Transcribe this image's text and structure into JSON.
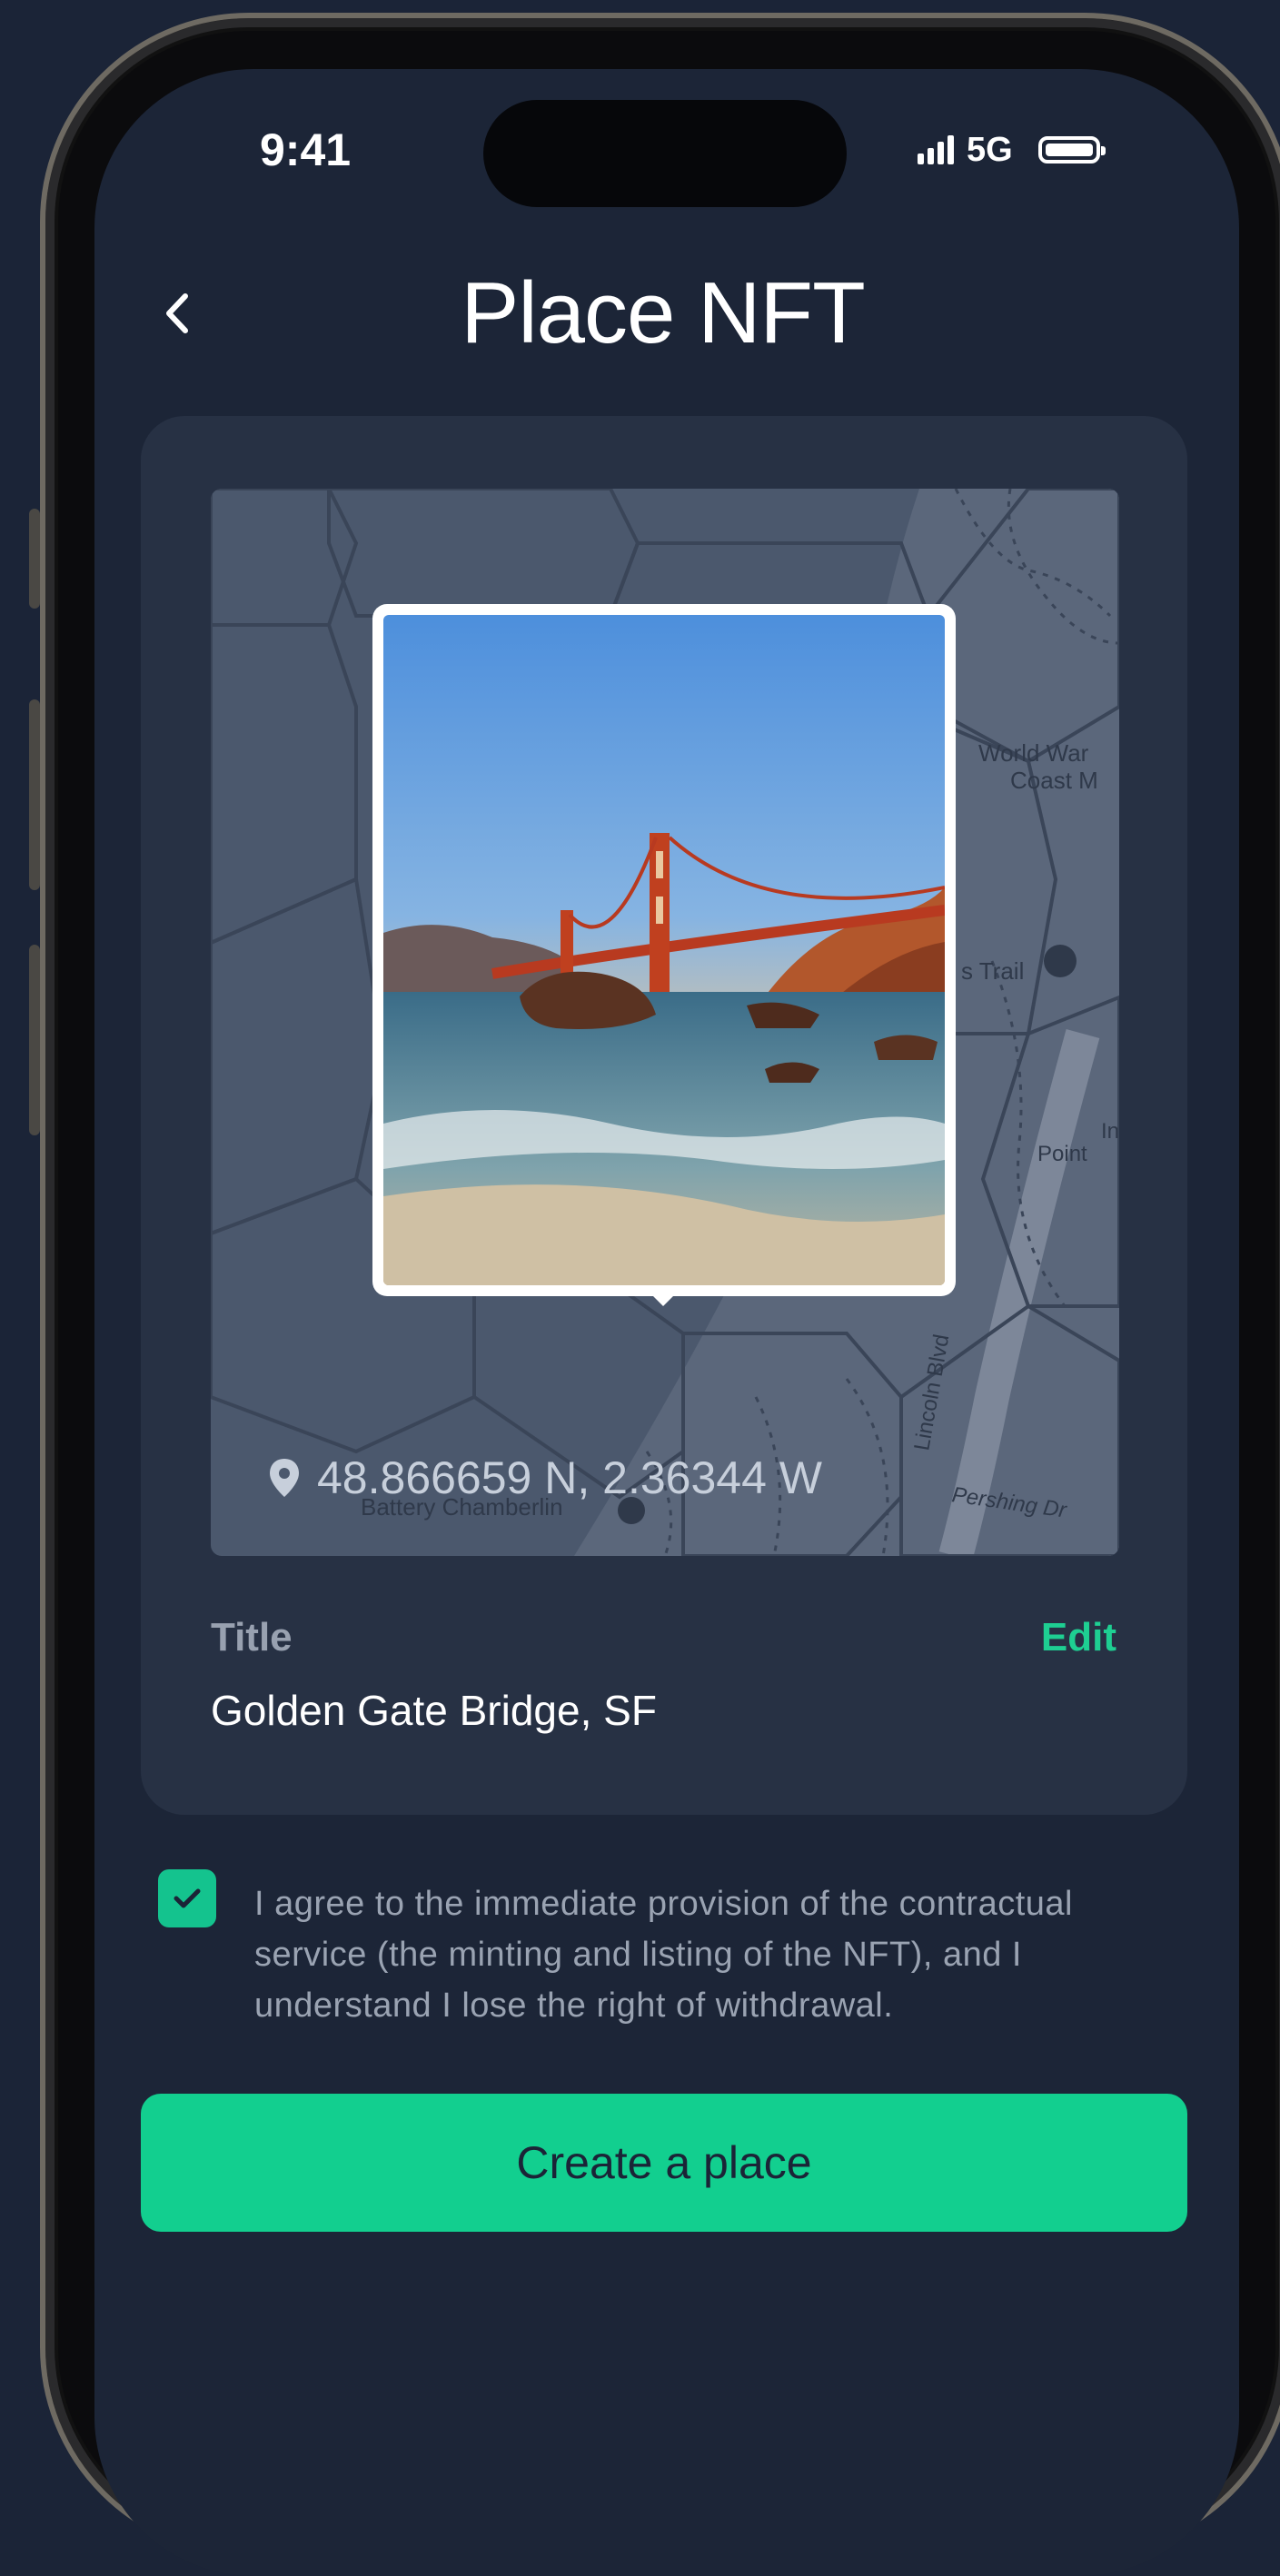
{
  "status_bar": {
    "time": "9:41",
    "network": "5G"
  },
  "header": {
    "title": "Place NFT",
    "back_icon": "chevron-left-icon"
  },
  "map": {
    "coordinates": "48.866659 N, 2.36344 W",
    "labels": {
      "world_war": "World War",
      "coast": "Coast M",
      "trail": "s Trail",
      "point": "Point",
      "inner": "In",
      "lincoln": "Lincoln Blvd",
      "pershing": "Pershing Dr",
      "battery": "Battery Chamberlin"
    },
    "pin_icon": "location-pin-icon"
  },
  "nft": {
    "title_label": "Title",
    "edit_label": "Edit",
    "title_value": "Golden Gate Bridge, SF"
  },
  "consent": {
    "checked": true,
    "text": "I agree to the immediate provision of the contractual service (the minting and listing of the NFT), and I understand I lose the right of withdrawal."
  },
  "cta": {
    "label": "Create a place"
  },
  "colors": {
    "accent": "#12cf8f",
    "background": "#1c2537",
    "card": "#273144",
    "map": "#4b586d"
  }
}
